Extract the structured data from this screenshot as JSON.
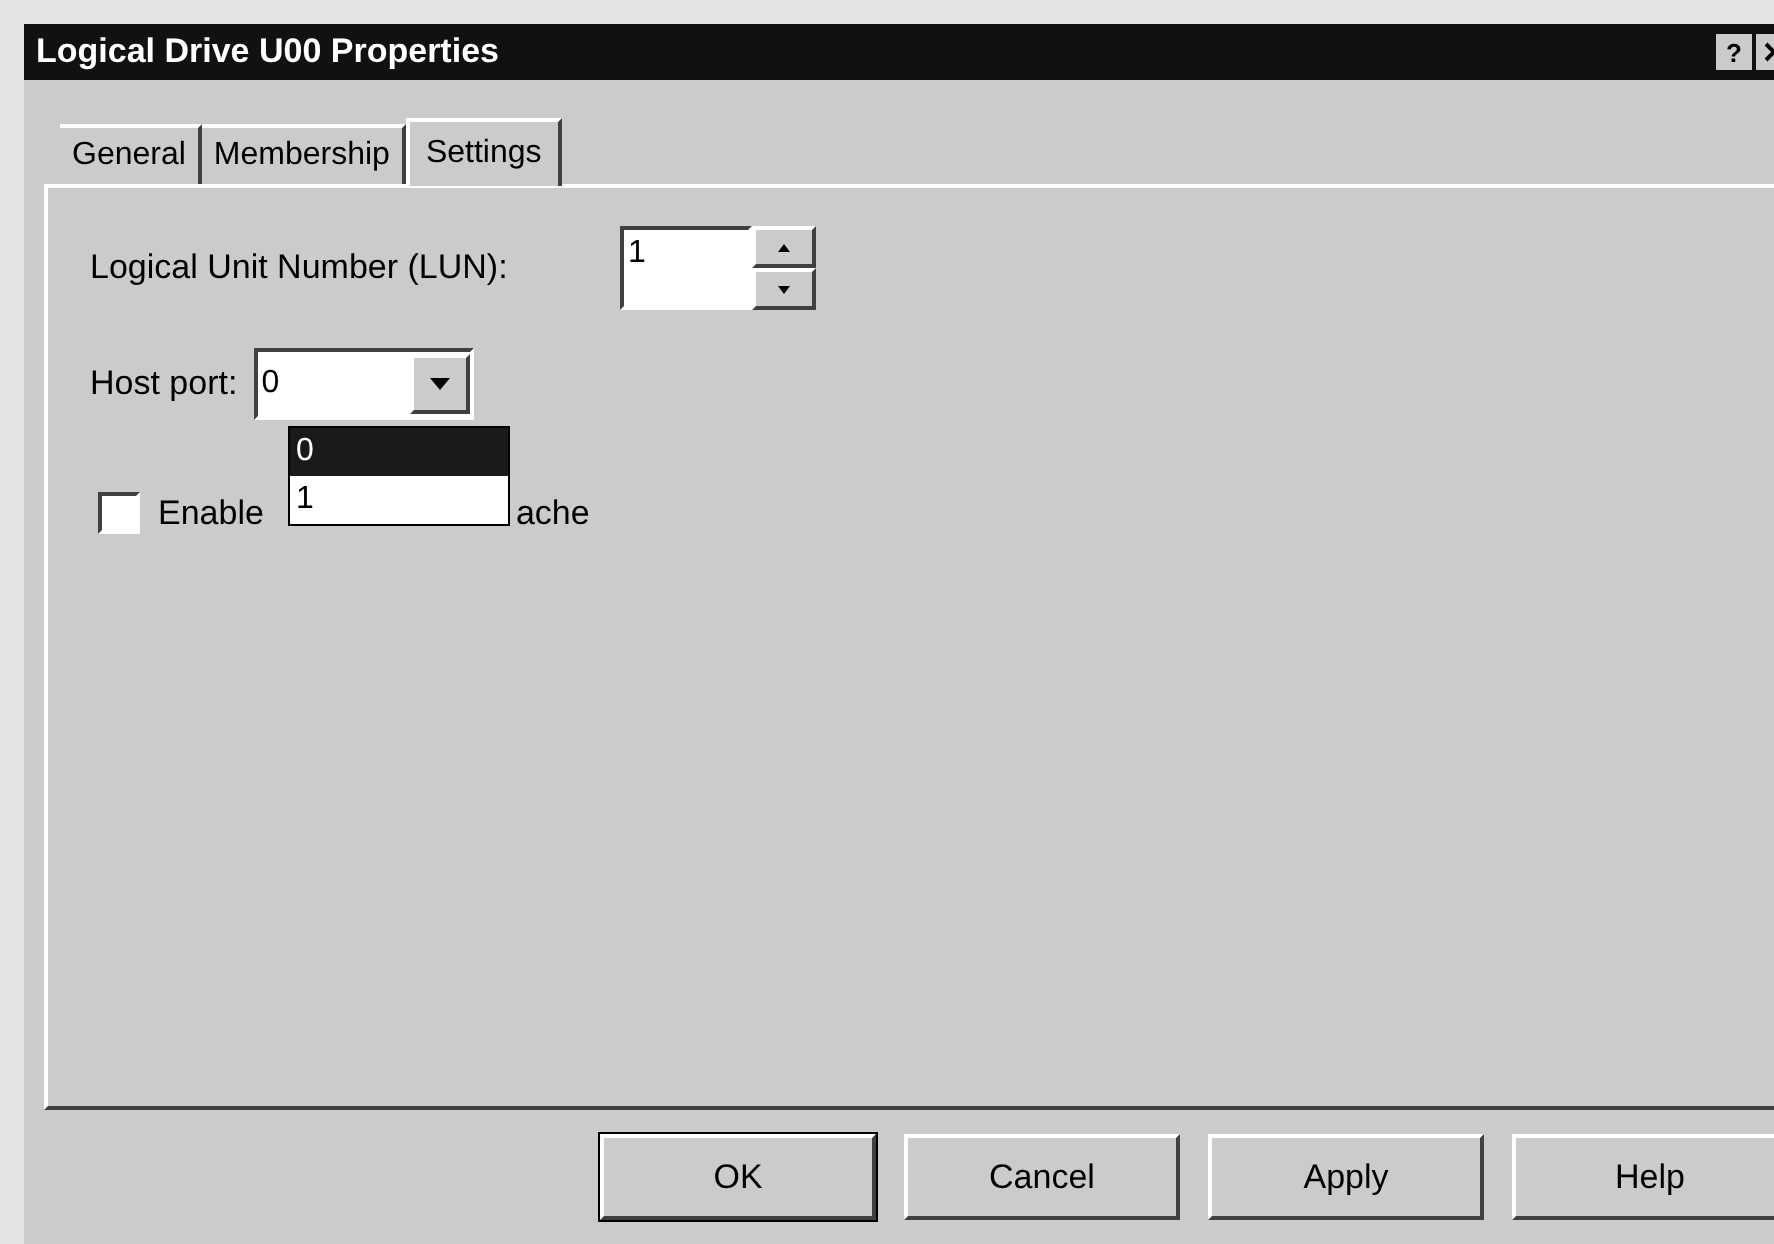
{
  "window": {
    "title": "Logical Drive U00 Properties",
    "help_button": "?"
  },
  "tabs": [
    {
      "label": "General",
      "selected": false
    },
    {
      "label": "Membership",
      "selected": false
    },
    {
      "label": "Settings",
      "selected": true
    }
  ],
  "lun": {
    "label": "Logical Unit Number (LUN):",
    "value": "1"
  },
  "host_port": {
    "label": "Host port:",
    "value": "0",
    "expanded": true,
    "options": [
      {
        "label": "0",
        "selected": true
      },
      {
        "label": "1",
        "selected": false
      }
    ]
  },
  "cache": {
    "label_start": "Enable",
    "label_end": "ache",
    "checked": false
  },
  "buttons": [
    {
      "label": "OK",
      "default": true
    },
    {
      "label": "Cancel",
      "default": false
    },
    {
      "label": "Apply",
      "default": false
    },
    {
      "label": "Help",
      "default": false
    }
  ]
}
